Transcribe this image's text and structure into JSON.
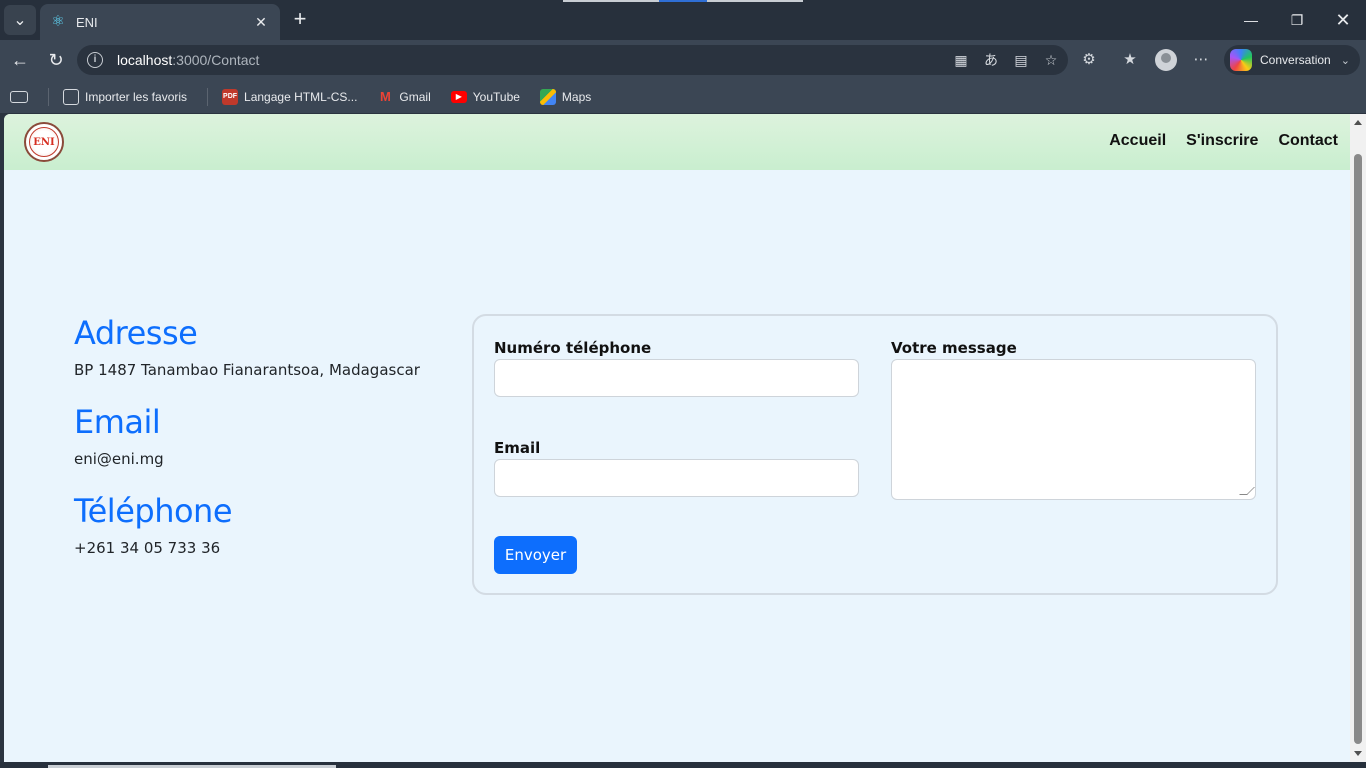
{
  "browser": {
    "tab_title": "ENI",
    "tab_favicon": "react-icon",
    "url_host": "localhost",
    "url_path": ":3000/Contact",
    "copilot_label": "Conversation",
    "bookmarks": [
      {
        "label": "Importer les favoris",
        "icon": "import-favorites-icon"
      },
      {
        "label": "Langage HTML-CS...",
        "icon": "pdf-icon"
      },
      {
        "label": "Gmail",
        "icon": "gmail-icon"
      },
      {
        "label": "YouTube",
        "icon": "youtube-icon"
      },
      {
        "label": "Maps",
        "icon": "maps-icon"
      }
    ]
  },
  "navbar": {
    "logo_text": "ENI",
    "links": [
      "Accueil",
      "S'inscrire",
      "Contact"
    ]
  },
  "contact": {
    "address_title": "Adresse",
    "address_value": "BP 1487 Tanambao Fianarantsoa, Madagascar",
    "email_title": "Email",
    "email_value": "eni@eni.mg",
    "phone_title": "Téléphone",
    "phone_value": "+261 34 05 733 36"
  },
  "form": {
    "phone_label": "Numéro téléphone",
    "phone_value": "",
    "email_label": "Email",
    "email_value": "",
    "message_label": "Votre message",
    "message_value": "",
    "submit_label": "Envoyer"
  },
  "colors": {
    "accent": "#0d6efd",
    "navbar_bg": "#d3f0d6",
    "page_bg": "#eaf5fd"
  }
}
